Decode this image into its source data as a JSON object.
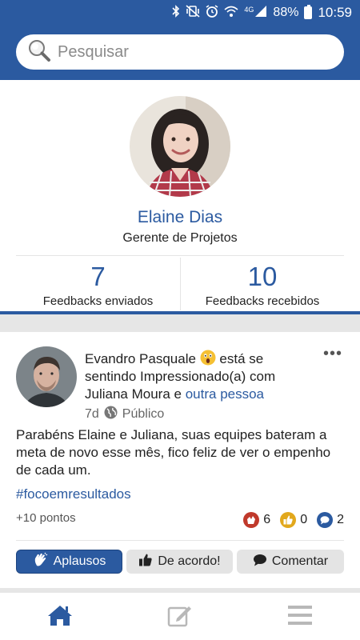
{
  "status_bar": {
    "battery_percent": "88%",
    "clock": "10:59",
    "network": "4G",
    "icons": [
      "bluetooth-icon",
      "vibrate-icon",
      "alarm-icon",
      "wifi-icon",
      "signal-icon",
      "battery-icon"
    ]
  },
  "search": {
    "placeholder": "Pesquisar"
  },
  "profile": {
    "name": "Elaine Dias",
    "role": "Gerente de Projetos",
    "stats": [
      {
        "value": "7",
        "label": "Feedbacks enviados"
      },
      {
        "value": "10",
        "label": "Feedbacks recebidos"
      }
    ]
  },
  "post": {
    "author": "Evandro Pasquale",
    "feeling_text_1": "está se sentindo Impressionado(a) com",
    "tagged_person": "Juliana Moura",
    "connector": "e",
    "others_link": "outra pessoa",
    "time": "7d",
    "visibility": "Público",
    "body": "Parabéns Elaine e Juliana, suas equipes bateram a meta de novo esse mês, fico feliz de ver o empenho de cada um.",
    "hashtag": "#focoemresultados",
    "points": "+10 pontos",
    "reactions": [
      {
        "icon": "clap-icon",
        "count": "6",
        "color": "#c0392b"
      },
      {
        "icon": "thumbs-up-icon",
        "count": "0",
        "color": "#e2a81c"
      },
      {
        "icon": "comment-icon",
        "count": "2",
        "color": "#2b5aa0"
      }
    ],
    "actions": {
      "applause": "Aplausos",
      "agree": "De acordo!",
      "comment": "Comentar"
    }
  },
  "bottom_nav": {
    "items": [
      "home-icon",
      "edit-icon",
      "menu-icon"
    ],
    "active": "home-icon"
  },
  "colors": {
    "brand": "#2b5aa0",
    "separator": "#e6e6e6",
    "button_gray": "#e4e4e4"
  }
}
